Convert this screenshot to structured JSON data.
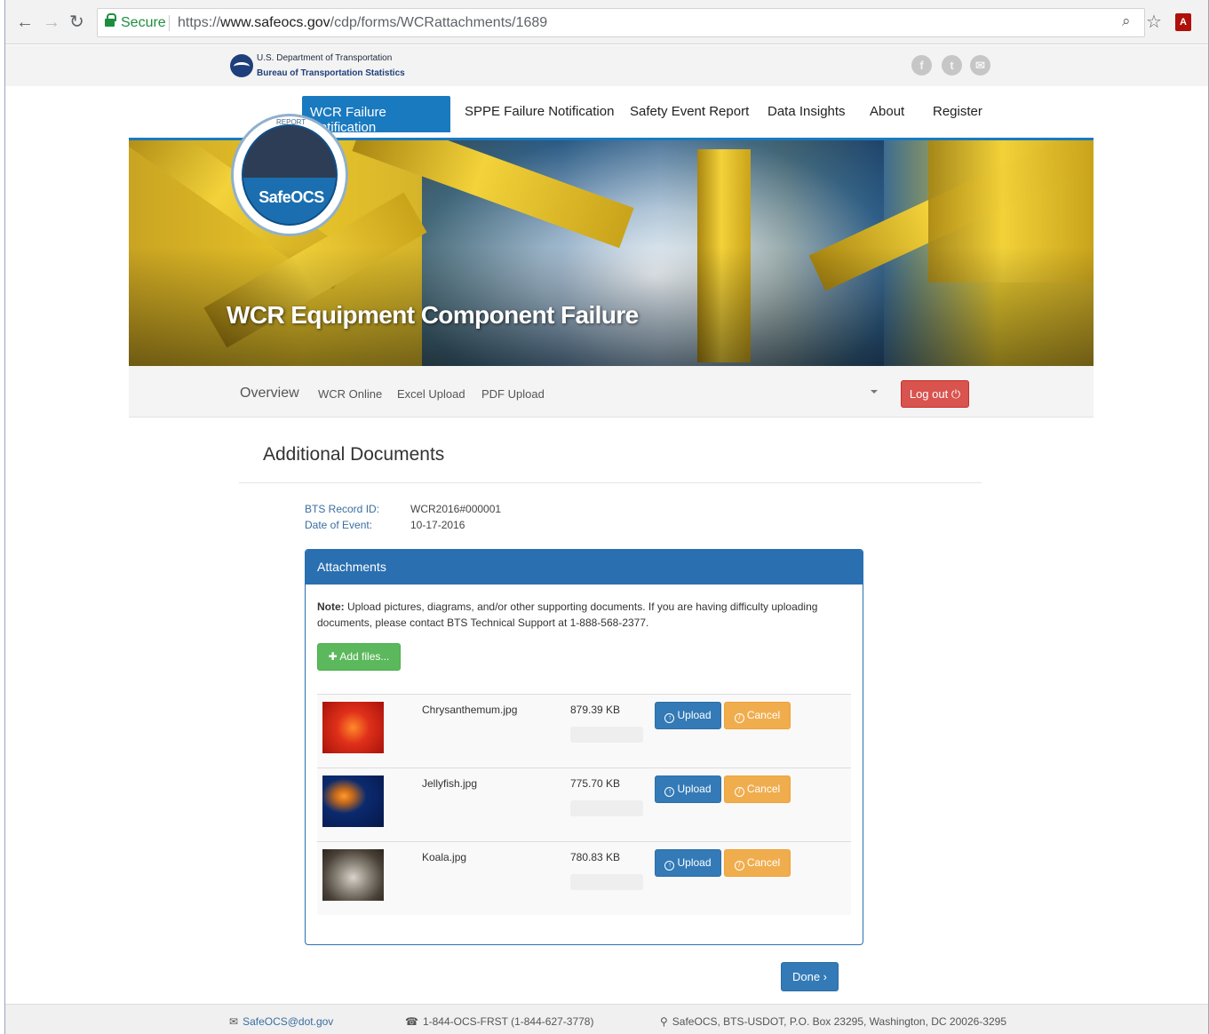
{
  "browser": {
    "secure_label": "Secure",
    "url_scheme": "https://",
    "url_host": "www.safeocs.gov",
    "url_path": "/cdp/forms/WCRattachments/1689"
  },
  "site_header": {
    "agency_line1": "U.S. Department of Transportation",
    "agency_line2": "Bureau of Transportation Statistics",
    "social": [
      {
        "icon": "facebook-icon",
        "glyph": "f"
      },
      {
        "icon": "twitter-icon",
        "glyph": "t"
      },
      {
        "icon": "email-icon",
        "glyph": "✉"
      }
    ]
  },
  "main_nav": {
    "items": [
      "WCR Failure Notification",
      "SPPE Failure Notification",
      "Safety Event Report",
      "Data Insights",
      "About",
      "Register"
    ]
  },
  "hero": {
    "badge_name": "SafeOCS",
    "badge_report": "REPORT",
    "title": "WCR Equipment Component Failure"
  },
  "sub_nav": {
    "items": [
      "Overview",
      "WCR Online",
      "Excel Upload",
      "PDF Upload"
    ],
    "logout_label": "Log out"
  },
  "content": {
    "title": "Additional Documents",
    "record_id_label": "BTS Record ID:",
    "record_id_value": "WCR2016#000001",
    "date_label": "Date of Event:",
    "date_value": "10-17-2016"
  },
  "attachments": {
    "header": "Attachments",
    "note_bold": "Note:",
    "note_text": " Upload pictures, diagrams, and/or other supporting documents. If you are having difficulty uploading documents, please contact BTS Technical Support at 1-888-568-2377.",
    "add_files_label": "Add files...",
    "upload_label": "Upload",
    "cancel_label": "Cancel",
    "files": [
      {
        "name": "Chrysanthemum.jpg",
        "size": "879.39 KB",
        "progress": 0
      },
      {
        "name": "Jellyfish.jpg",
        "size": "775.70 KB",
        "progress": 0
      },
      {
        "name": "Koala.jpg",
        "size": "780.83 KB",
        "progress": 0
      }
    ]
  },
  "done_label": "Done",
  "footer": {
    "email": "SafeOCS@dot.gov",
    "phone": "1-844-OCS-FRST (1-844-627-3778)",
    "address": "SafeOCS, BTS-USDOT, P.O. Box 23295, Washington, DC 20026-3295"
  },
  "colors": {
    "primary": "#1a7abf",
    "panel": "#2a6fb0",
    "success": "#5cb85c",
    "warning": "#f0ad4e",
    "danger": "#d9534f"
  }
}
